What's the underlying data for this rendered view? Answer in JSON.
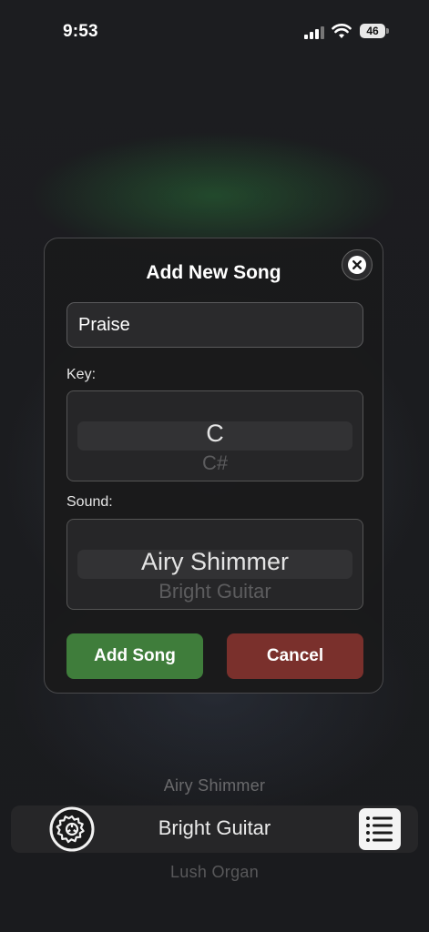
{
  "status_bar": {
    "time": "9:53",
    "battery": "46"
  },
  "dialog": {
    "title": "Add New Song",
    "name_input": {
      "value": "Praise",
      "placeholder": ""
    },
    "key": {
      "label": "Key:",
      "selected": "C",
      "next": "C#"
    },
    "sound": {
      "label": "Sound:",
      "selected": "Airy Shimmer",
      "next": "Bright Guitar"
    },
    "add_label": "Add Song",
    "cancel_label": "Cancel"
  },
  "sound_picker": {
    "above": "Airy Shimmer",
    "selected": "Bright Guitar",
    "below": "Lush Organ"
  },
  "colors": {
    "add_button": "#3f7d3b",
    "cancel_button": "#7a302c",
    "background": "#1b1c1e"
  },
  "icons": {
    "close": "close-icon",
    "settings": "settings-gear-icon",
    "list": "list-icon"
  }
}
